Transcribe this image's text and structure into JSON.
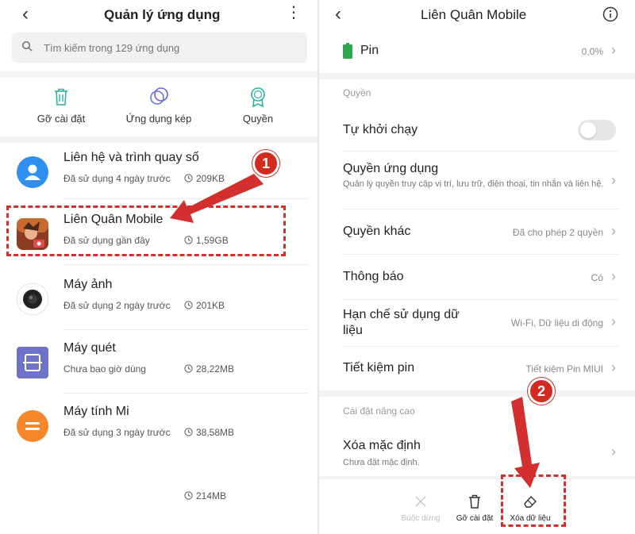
{
  "left": {
    "title": "Quản lý ứng dụng",
    "search_placeholder": "Tìm kiếm trong 129 ứng dụng",
    "actions": [
      {
        "label": "Gỡ cài đặt",
        "icon": "trash-icon"
      },
      {
        "label": "Ứng dụng kép",
        "icon": "dual-app-icon"
      },
      {
        "label": "Quyền",
        "icon": "permission-badge-icon"
      }
    ],
    "apps": [
      {
        "name": "Liên hệ và trình quay số",
        "last_used": "Đã sử dụng 4 ngày trước",
        "size": "209KB"
      },
      {
        "name": "Liên Quân Mobile",
        "last_used": "Đã sử dụng gần đây",
        "size": "1,59GB"
      },
      {
        "name": "Máy ảnh",
        "last_used": "Đã sử dụng 2 ngày trước",
        "size": "201KB"
      },
      {
        "name": "Máy quét",
        "last_used": "Chưa bao giờ dùng",
        "size": "28,22MB"
      },
      {
        "name": "Máy tính Mi",
        "last_used": "Đã sử dụng 3 ngày trước",
        "size": "38,58MB"
      }
    ],
    "partial_size": "214MB",
    "step_badge": "1"
  },
  "right": {
    "title": "Liên Quân Mobile",
    "battery": {
      "label": "Pin",
      "value": "0,0%"
    },
    "permissions_header": "Quyền",
    "autostart": {
      "label": "Tự khởi chạy",
      "enabled": false
    },
    "app_permissions": {
      "label": "Quyền ứng dụng",
      "desc": "Quản lý quyền truy cập vị trí, lưu trữ, điện thoại, tin nhắn và liên hệ."
    },
    "other_permissions": {
      "label": "Quyền khác",
      "value": "Đã cho phép 2 quyền"
    },
    "notifications": {
      "label": "Thông báo",
      "value": "Có"
    },
    "data_restrict": {
      "label": "Hạn chế sử dụng dữ liệu",
      "value": "Wi-Fi, Dữ liệu di động"
    },
    "battery_saver": {
      "label": "Tiết kiệm pin",
      "value": "Tiết kiệm Pin MIUI"
    },
    "advanced_header": "Cài đặt nâng cao",
    "clear_defaults": {
      "label": "Xóa mặc định",
      "desc": "Chưa đặt mặc định."
    },
    "bottom": {
      "force_stop": "Buộc dừng",
      "uninstall": "Gỡ cài đặt",
      "clear_data": "Xóa dữ liệu"
    },
    "step_badge": "2"
  },
  "colors": {
    "accent_teal": "#2bb5a0",
    "annotation_red": "#d32f2f",
    "battery_green": "#2ea84f"
  }
}
